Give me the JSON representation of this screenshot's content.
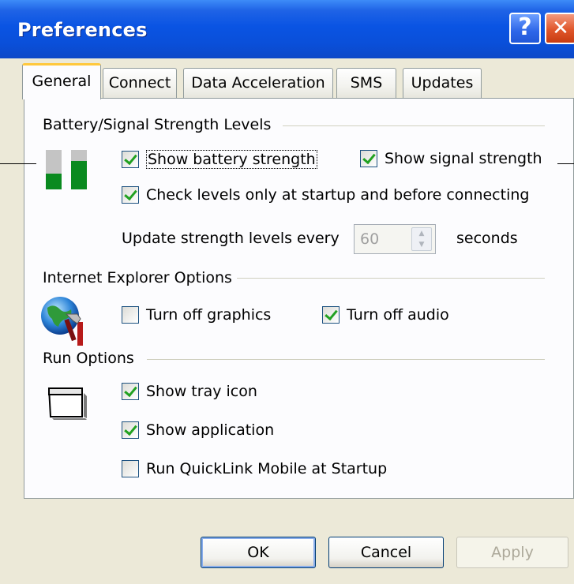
{
  "window": {
    "title": "Preferences",
    "help_glyph": "?",
    "close_glyph": "✕"
  },
  "tabs": [
    {
      "label": "General"
    },
    {
      "label": "Connect"
    },
    {
      "label": "Data Acceleration"
    },
    {
      "label": "SMS"
    },
    {
      "label": "Updates"
    }
  ],
  "battery": {
    "group_label": "Battery/Signal Strength Levels",
    "show_battery": {
      "label": "Show battery strength",
      "checked": true
    },
    "show_signal": {
      "label": "Show signal strength",
      "checked": true
    },
    "check_levels": {
      "label": "Check levels only at startup and before connecting",
      "checked": true
    },
    "update_label": "Update strength levels every",
    "update_value": "60",
    "update_unit": "seconds"
  },
  "ie": {
    "group_label": "Internet Explorer Options",
    "turn_off_graphics": {
      "label": "Turn off graphics",
      "checked": false
    },
    "turn_off_audio": {
      "label": "Turn off audio",
      "checked": true
    }
  },
  "run": {
    "group_label": "Run Options",
    "show_tray": {
      "label": "Show tray icon",
      "checked": true
    },
    "show_app": {
      "label": "Show application",
      "checked": true
    },
    "run_startup": {
      "label": "Run QuickLink Mobile at Startup",
      "checked": false
    }
  },
  "buttons": {
    "ok": "OK",
    "cancel": "Cancel",
    "apply": "Apply"
  },
  "colors": {
    "titlebar": "#0a54e3",
    "check": "#21a121",
    "face": "#ece9d8"
  }
}
